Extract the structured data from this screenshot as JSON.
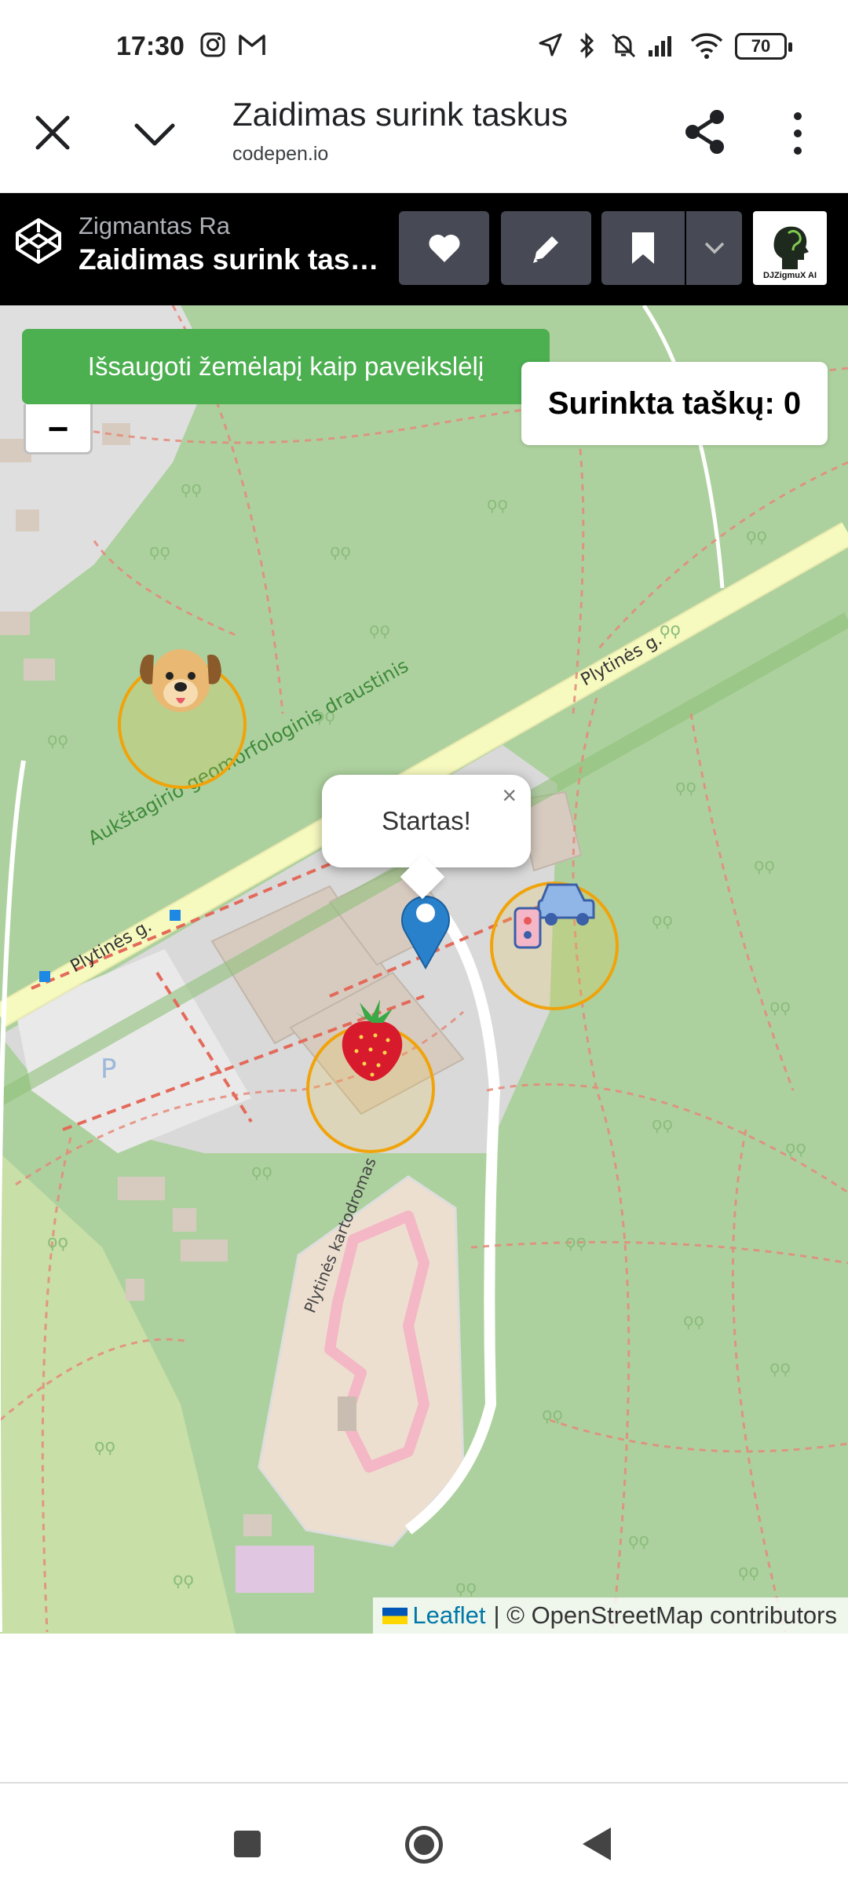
{
  "status_bar": {
    "time": "17:30",
    "battery": "70",
    "icons": [
      "instagram-icon",
      "gmail-icon",
      "location-icon",
      "bluetooth-icon",
      "mute-icon",
      "signal-icon",
      "wifi-icon",
      "battery-icon"
    ]
  },
  "browser": {
    "page_title": "Zaidimas surink taskus",
    "domain": "codepen.io",
    "icons": [
      "close-icon",
      "chevron-down-icon",
      "share-icon",
      "more-vert-icon"
    ]
  },
  "codepen": {
    "author": "Zigmantas Ra",
    "pen_title": "Zaidimas surink taskus",
    "buttons": [
      "heart-icon",
      "pencil-icon",
      "bookmark-icon",
      "chevron-down-icon"
    ],
    "avatar_text": "DJZigmuX AI"
  },
  "map": {
    "save_button_label": "Išsaugoti žemėlapį kaip paveikslėlį",
    "zoom_out_label": "−",
    "score_text": "Surinkta taškų: 0",
    "popup_text": "Startas!",
    "popup_close": "×",
    "street_labels": [
      "Plytinės g.",
      "Plytinės g.",
      "Aukštagirio geomorfologinis draustinis",
      "Plytinės kartodromas",
      "P"
    ],
    "markers": [
      "dog",
      "strawberry",
      "car"
    ],
    "attribution_link": "Leaflet",
    "attribution_text": "| © OpenStreetMap contributors"
  },
  "colors": {
    "accent_green": "#4caf50",
    "codepen_bg": "#000000",
    "marker_blue": "#2a81cb",
    "circle_orange": "#f0a30a",
    "map_forest": "#add19e"
  }
}
